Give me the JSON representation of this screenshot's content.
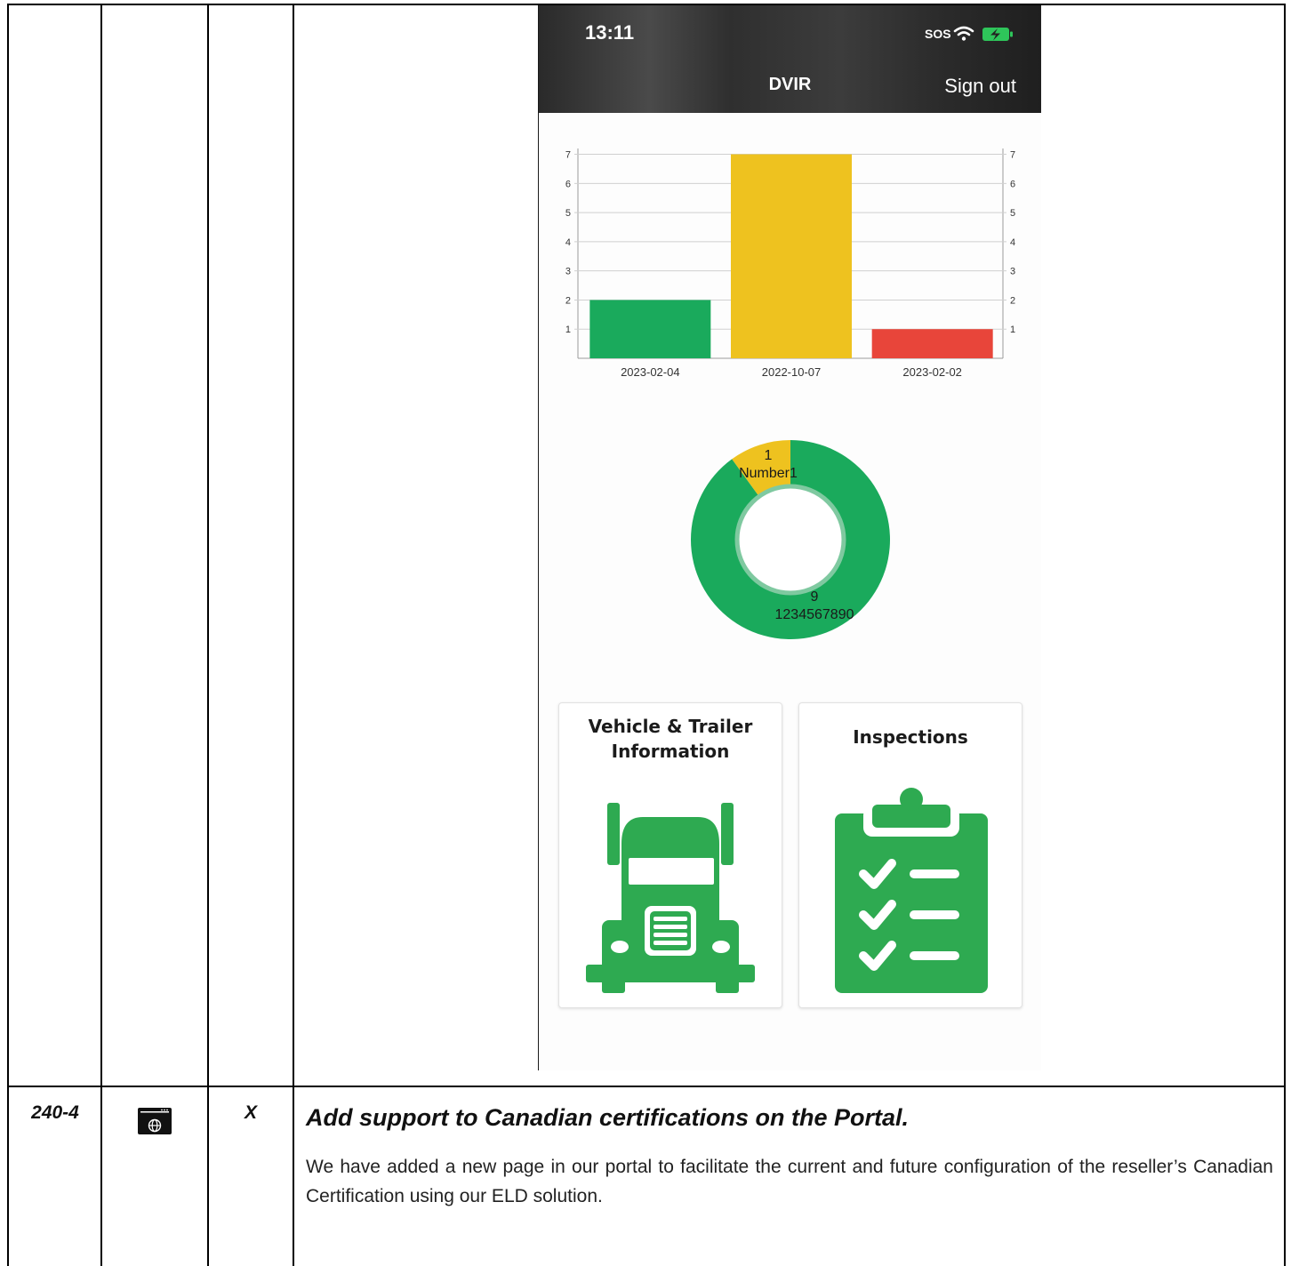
{
  "phone": {
    "status_time": "13:11",
    "status_sos": "SOS",
    "header_title": "DVIR",
    "sign_out_label": "Sign out"
  },
  "chart_data": {
    "type": "bar",
    "categories": [
      "2023-02-04",
      "2022-10-07",
      "2023-02-02"
    ],
    "values": [
      2,
      7,
      1
    ],
    "colors": [
      "#1aaa5c",
      "#eec21f",
      "#e8453a"
    ],
    "y_ticks": [
      1,
      2,
      3,
      4,
      5,
      6,
      7
    ],
    "ylim": [
      0,
      7
    ],
    "grid": true,
    "right_axis_mirrored": true
  },
  "donut_data": {
    "type": "pie",
    "slices": [
      {
        "label": "Number1",
        "value": 1,
        "color": "#eec21f"
      },
      {
        "label": "1234567890",
        "value": 9,
        "color": "#1aaa5c"
      }
    ]
  },
  "cards": [
    {
      "title_line1": "Vehicle & Trailer",
      "title_line2": "Information",
      "icon": "truck-icon"
    },
    {
      "title": "Inspections",
      "icon": "clipboard-checklist-icon"
    }
  ],
  "row": {
    "version": "240-4",
    "icon": "web-portal-icon",
    "mark": "X",
    "title": "Add support to Canadian certifications on the Portal.",
    "body": "We have added a new page in our portal to facilitate the current and future configuration of the reseller’s Canadian Certification using our ELD solution."
  }
}
